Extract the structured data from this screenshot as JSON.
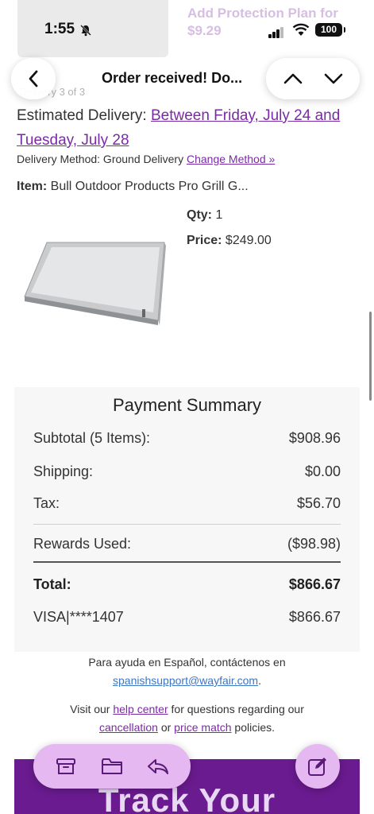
{
  "status_bar": {
    "time": "1:55",
    "battery": "100"
  },
  "background": {
    "protection_plan": "Add Protection Plan for $9.29",
    "delivery_count": "Delivery 3 of 3"
  },
  "nav": {
    "title": "Order received! Do..."
  },
  "delivery": {
    "estimated_label": "Estimated Delivery: ",
    "estimated_value": "Between Friday, July 24 and Tuesday, July 28",
    "method_label": "Delivery Method: Ground Delivery ",
    "change_method": "Change Method »",
    "item_label": "Item:",
    "item_value": " Bull Outdoor Products Pro Grill G...",
    "qty_label": "Qty:",
    "qty_value": " 1",
    "price_label": "Price:",
    "price_value": " $249.00"
  },
  "summary": {
    "title": "Payment Summary",
    "rows": [
      {
        "label": "Subtotal (5 Items):",
        "value": "$908.96"
      },
      {
        "label": "Shipping:",
        "value": "$0.00"
      },
      {
        "label": "Tax:",
        "value": "$56.70"
      },
      {
        "label": "Rewards Used:",
        "value": "($98.98)"
      },
      {
        "label": "Total:",
        "value": "$866.67"
      },
      {
        "label": "VISA|****1407",
        "value": "$866.67"
      }
    ]
  },
  "help": {
    "es_text": "Para ayuda en Español, contáctenos en",
    "es_email": "spanishsupport@wayfair.com",
    "es_period": ".",
    "visit": "Visit our ",
    "help_center": "help center",
    "for_questions": " for questions regarding our",
    "cancellation": "cancellation",
    "or": " or ",
    "price_match": "price match",
    "policies": " policies."
  },
  "banner": {
    "text": "Track Your"
  },
  "colors": {
    "accent": "#7b2aa6",
    "banner": "#6a1b8f",
    "toolbar": "#e6b8f2",
    "link_blue": "#3c76c4"
  }
}
